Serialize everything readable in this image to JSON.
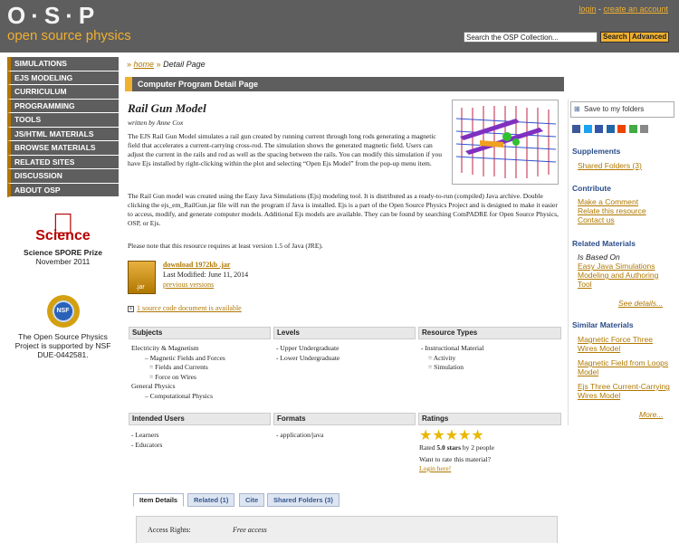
{
  "header": {
    "logo_text": "O·S·P",
    "tagline": "open source physics",
    "login": "login",
    "sep": "-",
    "create_account": "create an account",
    "search_placeholder": "Search the OSP Collection...",
    "search_button": "Search",
    "advanced_button": "Advanced"
  },
  "nav": {
    "items": [
      "SIMULATIONS",
      "EJS MODELING",
      "CURRICULUM",
      "PROGRAMMING",
      "TOOLS",
      "JS/HTML MATERIALS",
      "BROWSE MATERIALS",
      "RELATED SITES",
      "DISCUSSION",
      "ABOUT OSP"
    ]
  },
  "spore": {
    "logo_word": "Science",
    "title": "Science SPORE Prize",
    "date": "November 2011"
  },
  "nsf": {
    "seal": "NSF",
    "text": "The Open Source Physics Project is supported by NSF DUE-0442581."
  },
  "breadcrumb": {
    "home": "home",
    "sep": "»",
    "current": "Detail Page"
  },
  "page_title": "Computer Program Detail Page",
  "resource": {
    "title": "Rail Gun Model",
    "author": "written by Anne Cox",
    "p1": "The EJS Rail Gun Model simulates a rail gun created by running current through long rods generating a magnetic field that accelerates a current-carrying cross-rod. The simulation shows the generated magnetic field. Users can adjust the current in the rails and rod as well as the spacing between the rails. You can modify this simulation if you have Ejs installed by right-clicking within the plot and selecting “Open Ejs Model” from the pop-up menu item.",
    "p2": "The Rail Gun model was created using the Easy Java Simulations (Ejs) modeling tool.  It is distributed as a ready-to-run (compiled) Java archive.  Double clicking the ejs_em_RailGun.jar file will run the program if Java is installed.  Ejs is a part of the Open Source Physics Project and is designed to make it easier to access, modify, and generate computer models.  Additional Ejs models are available.  They can be found by searching ComPADRE for Open Source Physics, OSP, or Ejs.",
    "p3": "Please note that this resource requires at least version 1.5 of Java (JRE).",
    "download_label": "download 1972kb .jar",
    "jar_icon_label": ".jar",
    "last_modified": "Last Modified: June 11, 2014",
    "previous_versions": "previous versions",
    "source_docs": "1 source code document is available"
  },
  "subjects": {
    "headers": [
      "Subjects",
      "Levels",
      "Resource Types"
    ],
    "subjects_col": [
      {
        "indent": 0,
        "text": "Electricity & Magnetism"
      },
      {
        "indent": 1,
        "text": "– Magnetic Fields and Forces"
      },
      {
        "indent": 2,
        "text": "= Fields and Currents"
      },
      {
        "indent": 2,
        "text": "= Force on Wires"
      },
      {
        "indent": 0,
        "text": "General Physics"
      },
      {
        "indent": 1,
        "text": "– Computational Physics"
      }
    ],
    "levels_col": [
      "- Upper Undergraduate",
      "- Lower Undergraduate"
    ],
    "types_col": [
      {
        "indent": 0,
        "text": "- Instructional Material"
      },
      {
        "indent": 1,
        "text": "= Activity"
      },
      {
        "indent": 1,
        "text": "= Simulation"
      }
    ]
  },
  "users": {
    "headers": [
      "Intended Users",
      "Formats",
      "Ratings"
    ],
    "users_col": [
      "- Learners",
      "- Educators"
    ],
    "formats_col": [
      "- application/java"
    ],
    "rating_stars": 5,
    "rating_prefix": "Rated ",
    "rating_value": "5.0 stars",
    "rating_suffix": " by 2 people",
    "want_rate": "Want to rate this material?",
    "login_here": "Login here!"
  },
  "tabs": [
    "Item Details",
    "Related (1)",
    "Cite",
    "Shared Folders (3)"
  ],
  "details": {
    "access_label": "Access Rights:",
    "access_value": "Free access"
  },
  "right": {
    "save": "Save to my folders",
    "supplements_head": "Supplements",
    "shared_folders": "Shared Folders (3)",
    "contribute_head": "Contribute",
    "contribute_links": [
      "Make a Comment",
      "Relate this resource",
      "Contact us"
    ],
    "related_head": "Related Materials",
    "is_based_on": "Is Based On",
    "based_link": "Easy Java Simulations Modeling and Authoring Tool",
    "see_details": "See details...",
    "similar_head": "Similar Materials",
    "similar_links": [
      "Magnetic Force Three Wires Model",
      "Magnetic Field from Loops Model",
      "Ejs Three Current-Carrying Wires Model"
    ],
    "more": "More..."
  },
  "colors": {
    "header_bg": "#5e5e5e",
    "accent": "#f0b030",
    "link": "#b07800",
    "blue_heading": "#2a4d8a"
  }
}
